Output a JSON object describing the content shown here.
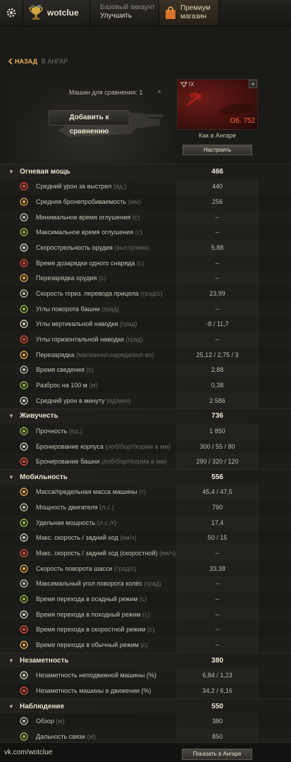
{
  "topbar": {
    "username": "wotclue",
    "account_line1": "Базовый аккаунт",
    "account_line2": "Улучшить",
    "premium_line1": "Премиум",
    "premium_line2": "магазин"
  },
  "nav": {
    "back_label": "НАЗАД",
    "back_target": "В АНГАР"
  },
  "compare": {
    "label": "Машин для сравнения: 1",
    "add_button": "Добавить к сравнению",
    "close": "×"
  },
  "tank": {
    "tier": "IX",
    "name": "Об. 752",
    "config_text": "Как в Ангаре",
    "config_button": "Настроить",
    "close": "×"
  },
  "sections": [
    {
      "title": "Огневая мощь",
      "total": "466",
      "items": [
        {
          "label": "Средний урон за выстрел",
          "unit": "(ед.)",
          "value": "440",
          "icon": "damage-icon"
        },
        {
          "label": "Средняя бронепробиваемость",
          "unit": "(мм)",
          "value": "256",
          "icon": "penetration-icon"
        },
        {
          "label": "Минимальное время оглушения",
          "unit": "(с)",
          "value": "--",
          "icon": "stun-min-icon"
        },
        {
          "label": "Максимальное время оглушения",
          "unit": "(с)",
          "value": "--",
          "icon": "stun-max-icon"
        },
        {
          "label": "Скорострельность орудия",
          "unit": "(выстр/мин)",
          "value": "5,88",
          "icon": "rate-of-fire-icon"
        },
        {
          "label": "Время дозарядки одного снаряда",
          "unit": "(с)",
          "value": "--",
          "icon": "shell-reload-icon"
        },
        {
          "label": "Перезарядка орудия",
          "unit": "(с)",
          "value": "--",
          "icon": "reload-icon"
        },
        {
          "label": "Скорость гориз. перевода прицела",
          "unit": "(град/с)",
          "value": "23,99",
          "icon": "traverse-icon"
        },
        {
          "label": "Углы поворота башни",
          "unit": "(град)",
          "value": "--",
          "icon": "turret-angle-icon"
        },
        {
          "label": "Углы вертикальной наводки",
          "unit": "(град)",
          "value": "-8 / 11,7",
          "icon": "elevation-icon"
        },
        {
          "label": "Углы горизонтальной наводки",
          "unit": "(град)",
          "value": "--",
          "icon": "horizontal-angle-icon"
        },
        {
          "label": "Перезарядка",
          "unit": "(магазина/снаряда/кол-во)",
          "value": "25,12 / 2,75 / 3",
          "icon": "clip-reload-icon"
        },
        {
          "label": "Время сведения",
          "unit": "(с)",
          "value": "2,88",
          "icon": "aim-time-icon"
        },
        {
          "label": "Разброс на 100 м",
          "unit": "(м)",
          "value": "0,38",
          "icon": "dispersion-icon"
        },
        {
          "label": "Средний урон в минуту",
          "unit": "(ед/мин)",
          "value": "2 586",
          "icon": "dpm-icon"
        }
      ]
    },
    {
      "title": "Живучесть",
      "total": "736",
      "items": [
        {
          "label": "Прочность",
          "unit": "(ед.)",
          "value": "1 850",
          "icon": "hitpoints-icon"
        },
        {
          "label": "Бронирование корпуса",
          "unit": "(лоб/борт/корма в мм)",
          "value": "300 / 55 / 80",
          "icon": "hull-armor-icon"
        },
        {
          "label": "Бронирование башни",
          "unit": "(лоб/борт/корма в мм)",
          "value": "290 / 320 / 120",
          "icon": "turret-armor-icon"
        }
      ]
    },
    {
      "title": "Мобильность",
      "total": "556",
      "items": [
        {
          "label": "Масса/предельная масса машины",
          "unit": "(т)",
          "value": "45,4 / 47,5",
          "icon": "weight-icon"
        },
        {
          "label": "Мощность двигателя",
          "unit": "(л.с.)",
          "value": "790",
          "icon": "engine-icon"
        },
        {
          "label": "Удельная мощность",
          "unit": "(л.с./т)",
          "value": "17,4",
          "icon": "power-ratio-icon"
        },
        {
          "label": "Макс. скорость / задний ход",
          "unit": "(км/ч)",
          "value": "50 / 15",
          "icon": "speed-icon"
        },
        {
          "label": "Макс. скорость / задний ход (скоростной)",
          "unit": "(км/ч)",
          "value": "--",
          "icon": "speed-fast-icon"
        },
        {
          "label": "Скорость поворота шасси",
          "unit": "(град/с)",
          "value": "33,38",
          "icon": "chassis-rotation-icon"
        },
        {
          "label": "Максимальный угол поворота колёс",
          "unit": "(град)",
          "value": "--",
          "icon": "wheel-angle-icon"
        },
        {
          "label": "Время перехода в осадный режим",
          "unit": "(с)",
          "value": "--",
          "icon": "siege-mode-icon"
        },
        {
          "label": "Время перехода в походный режим",
          "unit": "(с)",
          "value": "--",
          "icon": "travel-mode-icon"
        },
        {
          "label": "Время перехода в скоростной режим",
          "unit": "(с)",
          "value": "--",
          "icon": "fast-mode-icon"
        },
        {
          "label": "Время перехода в обычный режим",
          "unit": "(с)",
          "value": "--",
          "icon": "normal-mode-icon"
        }
      ]
    },
    {
      "title": "Незаметность",
      "total": "380",
      "items": [
        {
          "label": "Незаметность неподвижной машины (%)",
          "unit": "",
          "value": "6,84 / 1,23",
          "icon": "camo-stationary-icon"
        },
        {
          "label": "Незаметность машины в движении (%)",
          "unit": "",
          "value": "34,2 / 6,16",
          "icon": "camo-moving-icon"
        }
      ]
    },
    {
      "title": "Наблюдение",
      "total": "550",
      "items": [
        {
          "label": "Обзор",
          "unit": "(м)",
          "value": "380",
          "icon": "view-range-icon"
        },
        {
          "label": "Дальность связи",
          "unit": "(м)",
          "value": "850",
          "icon": "radio-range-icon"
        }
      ]
    }
  ],
  "footer": {
    "watermark": "vk.com/wotclue",
    "show_button": "Показать в Ангаре"
  },
  "colors": {
    "accent_orange": "#f0b45a",
    "tank_name_red": "#ff6a40",
    "background": "#1a1a17"
  }
}
